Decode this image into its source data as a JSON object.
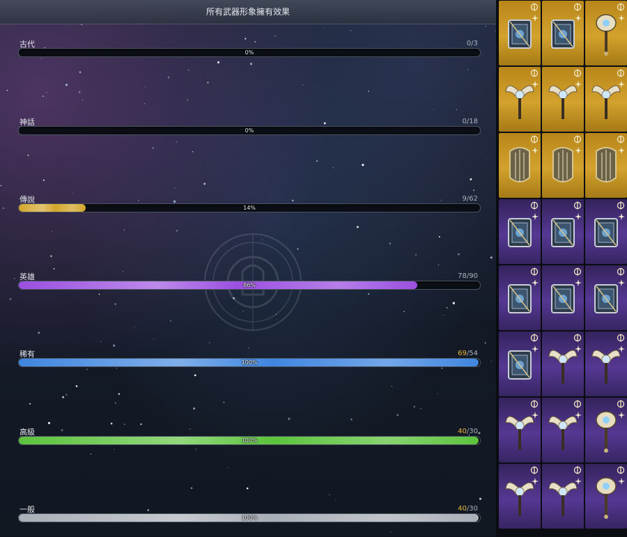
{
  "panel": {
    "title": "所有武器形象擁有效果",
    "tiers": [
      {
        "name": "古代",
        "have": "0",
        "sep": "/",
        "total": "3",
        "percent_label": "0%",
        "fill": 0.0,
        "over": false,
        "color": "#c9a236"
      },
      {
        "name": "神話",
        "have": "0",
        "sep": "/",
        "total": "18",
        "percent_label": "0%",
        "fill": 0.0,
        "over": false,
        "color": "#c9a236"
      },
      {
        "name": "傳說",
        "have": "9",
        "sep": "/",
        "total": "62",
        "percent_label": "14%",
        "fill": 0.145,
        "over": false,
        "color": "#d4a52a"
      },
      {
        "name": "英雄",
        "have": "78",
        "sep": "/",
        "total": "90",
        "percent_label": "86%",
        "fill": 0.867,
        "over": false,
        "color": "#9b4fe0"
      },
      {
        "name": "稀有",
        "have": "69",
        "sep": "/",
        "total": "54",
        "percent_label": "100%",
        "fill": 1.0,
        "over": true,
        "color": "#3f86e0"
      },
      {
        "name": "高級",
        "have": "40",
        "sep": "/",
        "total": "30",
        "percent_label": "100%",
        "fill": 1.0,
        "over": true,
        "color": "#5cc33c"
      },
      {
        "name": "一般",
        "have": "40",
        "sep": "/",
        "total": "30",
        "percent_label": "100%",
        "fill": 1.0,
        "over": true,
        "color": "#a9afb7"
      }
    ]
  },
  "grid": {
    "cells": [
      {
        "rarity": "gold",
        "icon": "spellbook-icon",
        "class_icon": "tome-class-icon"
      },
      {
        "rarity": "gold",
        "icon": "spellbook-icon",
        "class_icon": "tome-class-icon"
      },
      {
        "rarity": "gold",
        "icon": "mace-icon",
        "class_icon": "mace-class-icon"
      },
      {
        "rarity": "gold",
        "icon": "winged-staff-icon",
        "class_icon": "staff-class-icon"
      },
      {
        "rarity": "gold",
        "icon": "winged-staff-icon",
        "class_icon": "staff-class-icon"
      },
      {
        "rarity": "gold",
        "icon": "winged-staff-icon",
        "class_icon": "mace-class-icon"
      },
      {
        "rarity": "gold",
        "icon": "harp-icon",
        "class_icon": "harp-class-icon"
      },
      {
        "rarity": "gold",
        "icon": "harp-icon",
        "class_icon": "harp-class-icon"
      },
      {
        "rarity": "gold",
        "icon": "harp-icon",
        "class_icon": "harp-class-icon"
      },
      {
        "rarity": "purple",
        "icon": "spellbook-icon",
        "class_icon": "tome-class-icon"
      },
      {
        "rarity": "purple",
        "icon": "spellbook-icon",
        "class_icon": "tome-class-icon"
      },
      {
        "rarity": "purple",
        "icon": "spellbook-icon",
        "class_icon": "tome-class-icon"
      },
      {
        "rarity": "purple",
        "icon": "spellbook-icon",
        "class_icon": "tome-class-icon"
      },
      {
        "rarity": "purple",
        "icon": "spellbook-icon",
        "class_icon": "tome-class-icon"
      },
      {
        "rarity": "purple",
        "icon": "spellbook-icon",
        "class_icon": "tome-class-icon"
      },
      {
        "rarity": "purple",
        "icon": "spellbook-icon",
        "class_icon": "tome-class-icon"
      },
      {
        "rarity": "purple",
        "icon": "winged-staff-icon",
        "class_icon": "staff-class-icon"
      },
      {
        "rarity": "purple",
        "icon": "winged-staff-icon",
        "class_icon": "staff-class-icon"
      },
      {
        "rarity": "purple",
        "icon": "winged-staff-icon",
        "class_icon": "staff-class-icon"
      },
      {
        "rarity": "purple",
        "icon": "winged-staff-icon",
        "class_icon": "staff-class-icon"
      },
      {
        "rarity": "purple",
        "icon": "mace-icon",
        "class_icon": "staff-class-icon"
      },
      {
        "rarity": "purple",
        "icon": "winged-staff-icon",
        "class_icon": "staff-class-icon"
      },
      {
        "rarity": "purple",
        "icon": "winged-staff-icon",
        "class_icon": "staff-class-icon"
      },
      {
        "rarity": "purple",
        "icon": "mace-icon",
        "class_icon": "staff-class-icon"
      }
    ],
    "colors": {
      "gold": "#d3a22c",
      "purple": "#553893"
    }
  }
}
